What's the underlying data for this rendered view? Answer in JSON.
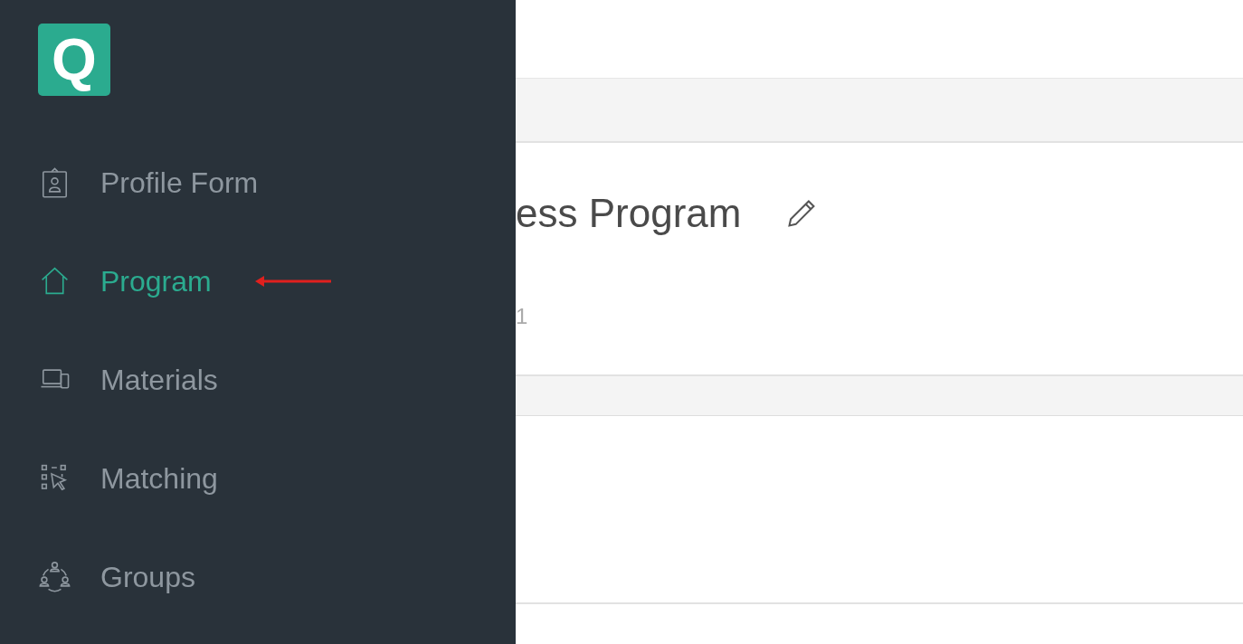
{
  "sidebar": {
    "logo": "Q",
    "items": [
      {
        "label": "Profile Form",
        "kind": "badge",
        "selected": false,
        "marked": false
      },
      {
        "label": "Program",
        "kind": "house",
        "selected": true,
        "marked": true
      },
      {
        "label": "Materials",
        "kind": "devices",
        "selected": false,
        "marked": false
      },
      {
        "label": "Matching",
        "kind": "select",
        "selected": false,
        "marked": false
      },
      {
        "label": "Groups",
        "kind": "group",
        "selected": false,
        "marked": false
      }
    ]
  },
  "main": {
    "title": "ess Program",
    "subtitle": "1"
  }
}
